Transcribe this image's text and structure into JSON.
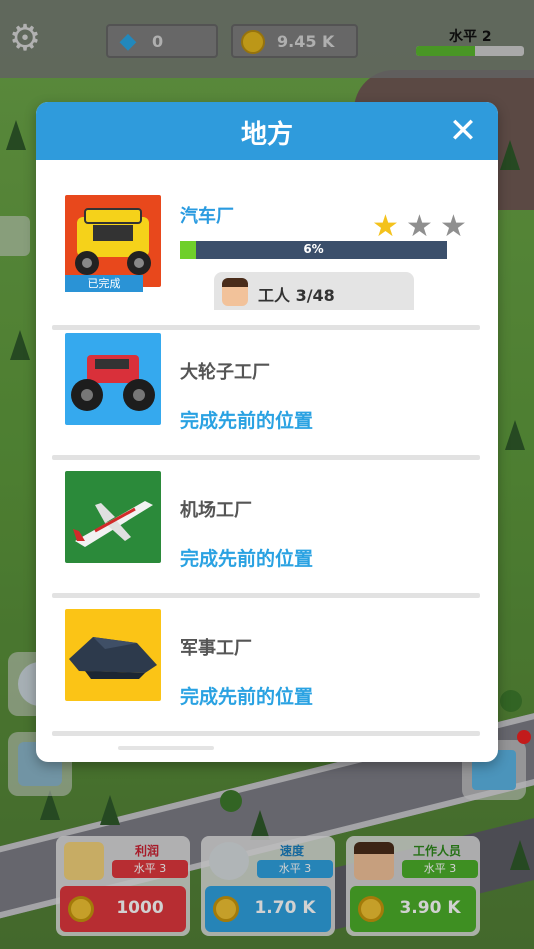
{
  "hud": {
    "gems": "0",
    "coins": "9.45 K",
    "level_label": "水平 2",
    "level_progress": 0.55
  },
  "modal": {
    "title": "地方",
    "close_symbol": "✕",
    "factories": [
      {
        "name": "汽车厂",
        "status": "已完成",
        "progress_label": "6%",
        "progress": 0.06,
        "stars_earned": 1,
        "stars_total": 3,
        "workers": "工人 3/48"
      },
      {
        "name": "大轮子工厂",
        "hint": "完成先前的位置"
      },
      {
        "name": "机场工厂",
        "hint": "完成先前的位置"
      },
      {
        "name": "军事工厂",
        "hint": "完成先前的位置"
      }
    ]
  },
  "panels": {
    "profit": {
      "title": "利润",
      "level": "水平 3",
      "value": "1000",
      "color": "#e0383e",
      "level_color": "#e0383e"
    },
    "speed": {
      "title": "速度",
      "level": "水平 3",
      "value": "1.70 K",
      "color": "#2fa2e0",
      "level_color": "#2fa2e0"
    },
    "workers": {
      "title": "工作人员",
      "level": "水平 3",
      "value": "3.90 K",
      "color": "#4caf2a",
      "level_color": "#4caf2a"
    }
  },
  "colors": {
    "header_blue": "#2f9bdc",
    "link_blue": "#2aa2e2",
    "star_gold": "#f4c21c"
  }
}
